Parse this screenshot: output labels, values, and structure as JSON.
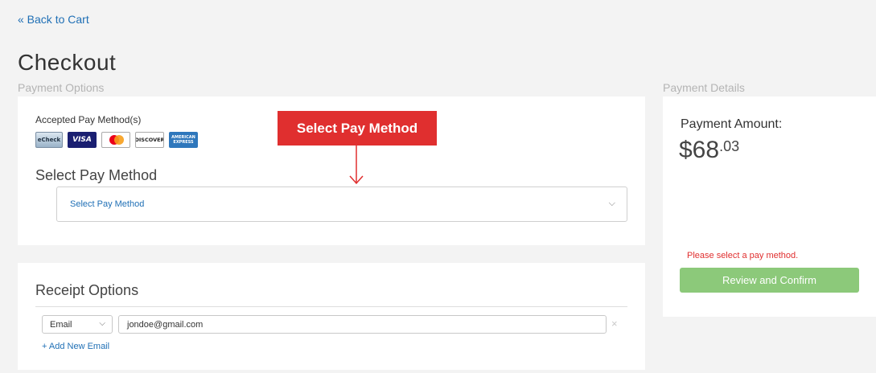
{
  "nav": {
    "back_label": "« Back to Cart"
  },
  "page": {
    "title": "Checkout"
  },
  "payment_options": {
    "caption": "Payment Options",
    "accepted_label": "Accepted Pay Method(s)",
    "cards": [
      {
        "name": "echeck",
        "label": "eCheck"
      },
      {
        "name": "visa",
        "label": "VISA"
      },
      {
        "name": "mastercard",
        "label": ""
      },
      {
        "name": "discover",
        "label": "DISCOVER"
      },
      {
        "name": "amex",
        "label": "AMERICAN EXPRESS"
      }
    ],
    "select_heading": "Select Pay Method",
    "select_value": "Select Pay Method"
  },
  "callout": {
    "label": "Select Pay Method",
    "color": "#e02f2f"
  },
  "receipt": {
    "heading": "Receipt Options",
    "type_value": "Email",
    "email_value": "jondoe@gmail.com",
    "remove_glyph": "×",
    "add_label": "+ Add New Email"
  },
  "payment_details": {
    "caption": "Payment Details",
    "amount_label": "Payment Amount:",
    "amount_main": "$68",
    "amount_cents": ".03",
    "error": "Please select a pay method.",
    "review_button": "Review and Confirm",
    "button_color": "#8cc97a"
  }
}
